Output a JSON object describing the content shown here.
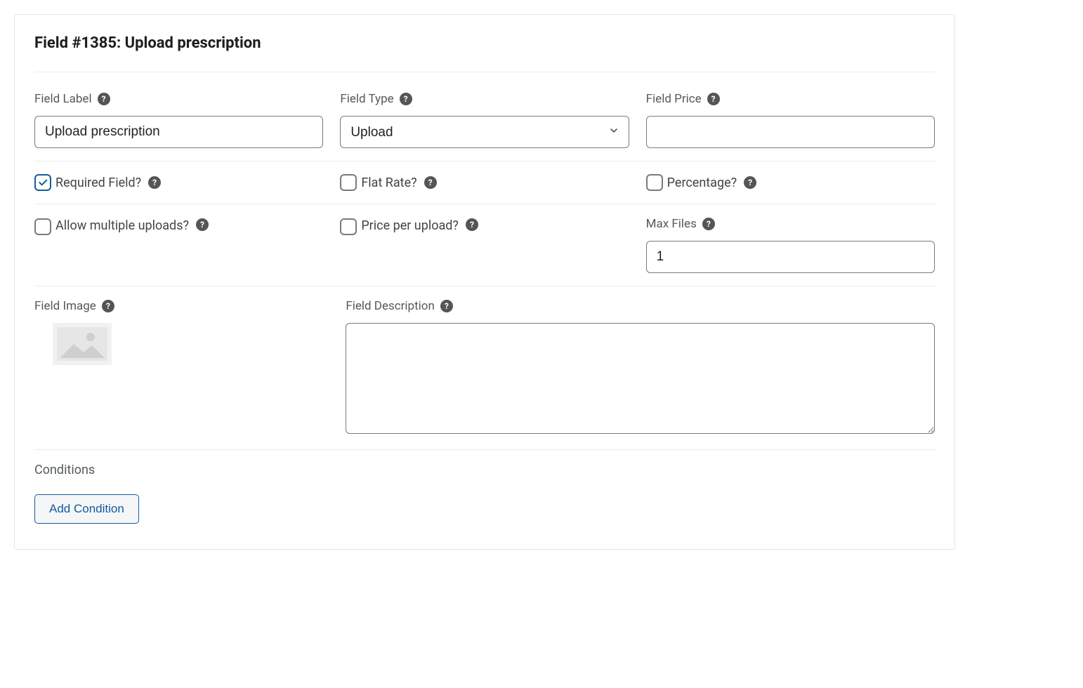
{
  "title": "Field #1385: Upload prescription",
  "fieldLabel": {
    "label": "Field Label",
    "value": "Upload prescription"
  },
  "fieldType": {
    "label": "Field Type",
    "selected": "Upload",
    "options": [
      "Upload"
    ]
  },
  "fieldPrice": {
    "label": "Field Price",
    "value": ""
  },
  "checkboxes": {
    "required": {
      "label": "Required Field?",
      "checked": true
    },
    "flatRate": {
      "label": "Flat Rate?",
      "checked": false
    },
    "percentage": {
      "label": "Percentage?",
      "checked": false
    },
    "multipleUploads": {
      "label": "Allow multiple uploads?",
      "checked": false
    },
    "pricePerUpload": {
      "label": "Price per upload?",
      "checked": false
    }
  },
  "maxFiles": {
    "label": "Max Files",
    "value": "1"
  },
  "fieldImage": {
    "label": "Field Image"
  },
  "fieldDescription": {
    "label": "Field Description",
    "value": ""
  },
  "conditions": {
    "label": "Conditions",
    "addButton": "Add Condition"
  }
}
